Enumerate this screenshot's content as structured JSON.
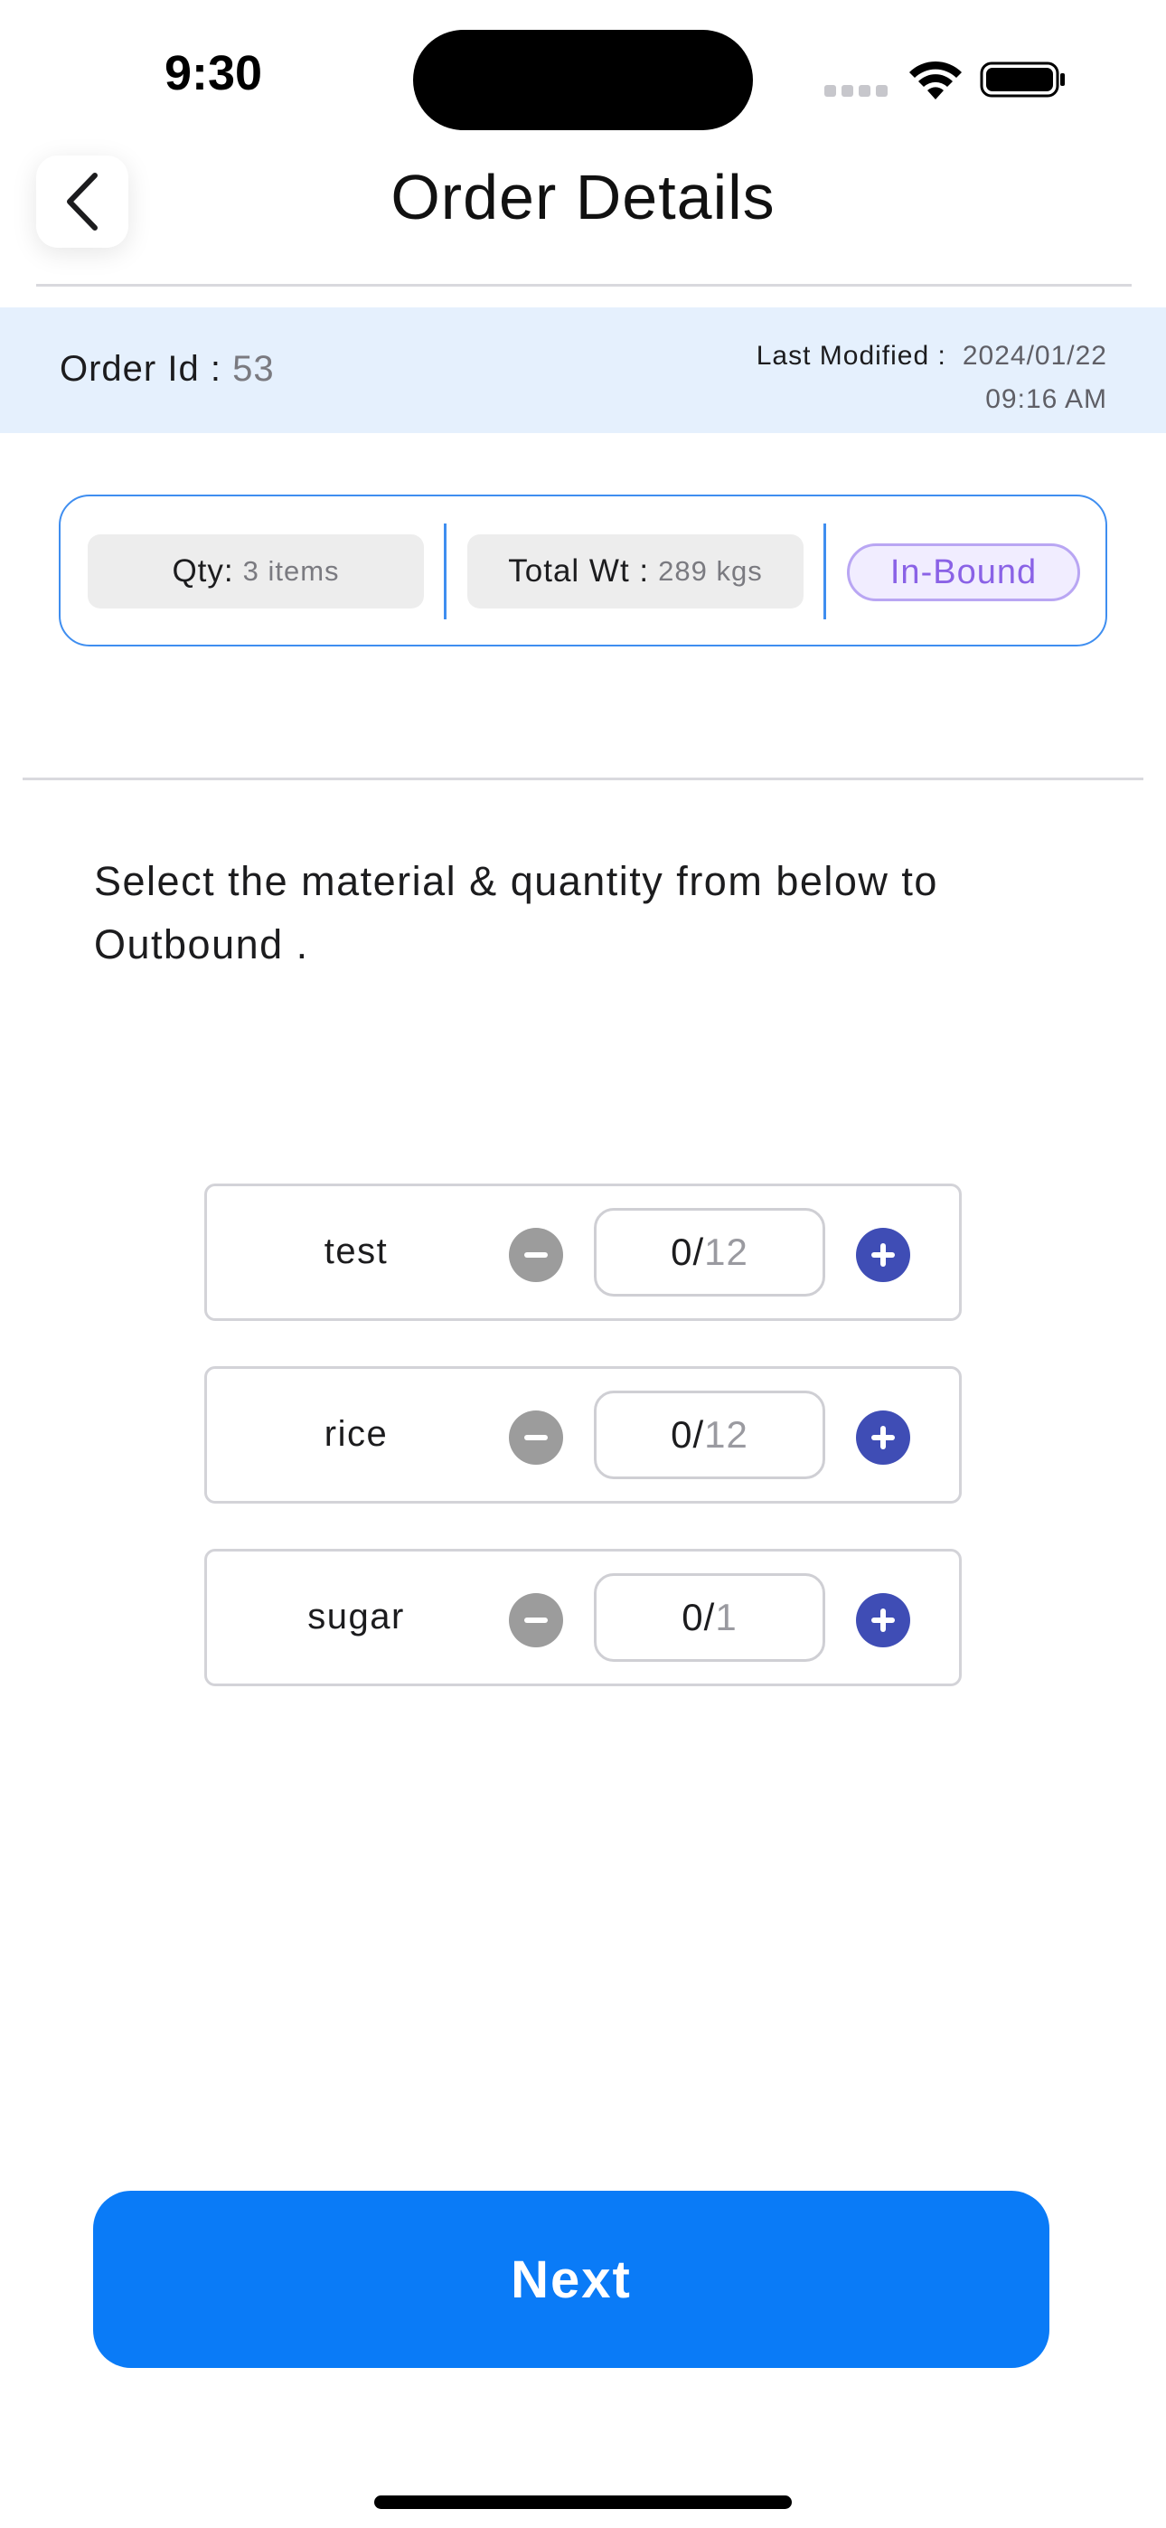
{
  "status_bar": {
    "time": "9:30"
  },
  "header": {
    "title": "Order Details",
    "back_icon": "chevron-left-icon"
  },
  "order_info": {
    "order_id_label": "Order Id :",
    "order_id_value": "53",
    "last_modified_label": "Last Modified :",
    "last_modified_date": "2024/01/22",
    "last_modified_time": "09:16 AM"
  },
  "summary": {
    "qty_label": "Qty:",
    "qty_value": "3 items",
    "weight_label": "Total Wt :",
    "weight_value": "289 kgs",
    "status": "In-Bound"
  },
  "instruction_text": "Select the material & quantity from below to Outbound .",
  "materials": [
    {
      "name": "test",
      "selected": "0",
      "max": "12"
    },
    {
      "name": "rice",
      "selected": "0",
      "max": "12"
    },
    {
      "name": "sugar",
      "selected": "0",
      "max": "1"
    }
  ],
  "next_label": "Next",
  "colors": {
    "primary": "#0a7bf7",
    "info_bar_bg": "#e5f0fd",
    "card_border": "#3f8ef0",
    "badge_text": "#8a62e6",
    "plus_button": "#3f4db5",
    "minus_button": "#9c9c9c"
  }
}
